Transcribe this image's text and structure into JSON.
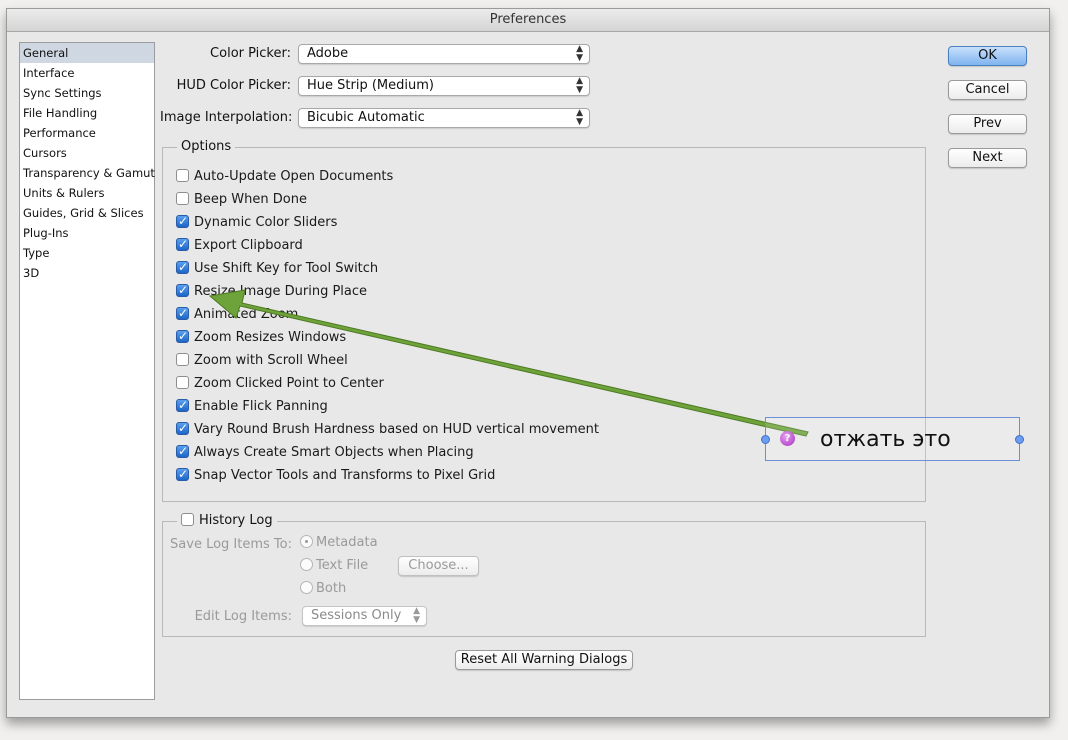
{
  "window": {
    "title": "Preferences"
  },
  "sidebar": {
    "items": [
      {
        "label": "General",
        "selected": true
      },
      {
        "label": "Interface"
      },
      {
        "label": "Sync Settings"
      },
      {
        "label": "File Handling"
      },
      {
        "label": "Performance"
      },
      {
        "label": "Cursors"
      },
      {
        "label": "Transparency & Gamut"
      },
      {
        "label": "Units & Rulers"
      },
      {
        "label": "Guides, Grid & Slices"
      },
      {
        "label": "Plug-Ins"
      },
      {
        "label": "Type"
      },
      {
        "label": "3D"
      }
    ]
  },
  "pickers": {
    "color_picker": {
      "label": "Color Picker:",
      "value": "Adobe"
    },
    "hud_color_picker": {
      "label": "HUD Color Picker:",
      "value": "Hue Strip (Medium)"
    },
    "image_interpolation": {
      "label": "Image Interpolation:",
      "value": "Bicubic Automatic"
    }
  },
  "options": {
    "legend": "Options",
    "checkboxes": [
      {
        "label": "Auto-Update Open Documents",
        "checked": false
      },
      {
        "label": "Beep When Done",
        "checked": false
      },
      {
        "label": "Dynamic Color Sliders",
        "checked": true
      },
      {
        "label": "Export Clipboard",
        "checked": true
      },
      {
        "label": "Use Shift Key for Tool Switch",
        "checked": true
      },
      {
        "label": "Resize Image During Place",
        "checked": true
      },
      {
        "label": "Animated Zoom",
        "checked": true
      },
      {
        "label": "Zoom Resizes Windows",
        "checked": true
      },
      {
        "label": "Zoom with Scroll Wheel",
        "checked": false
      },
      {
        "label": "Zoom Clicked Point to Center",
        "checked": false
      },
      {
        "label": "Enable Flick Panning",
        "checked": true
      },
      {
        "label": "Vary Round Brush Hardness based on HUD vertical movement",
        "checked": true
      },
      {
        "label": "Always Create Smart Objects when Placing",
        "checked": true
      },
      {
        "label": "Snap Vector Tools and Transforms to Pixel Grid",
        "checked": true
      }
    ]
  },
  "history": {
    "legend": "History Log",
    "checked": false,
    "save_label": "Save Log Items To:",
    "radios": [
      "Metadata",
      "Text File",
      "Both"
    ],
    "selected": "Metadata",
    "choose_button": "Choose...",
    "edit_label": "Edit Log Items:",
    "edit_value": "Sessions Only"
  },
  "buttons": {
    "ok": "OK",
    "cancel": "Cancel",
    "prev": "Prev",
    "next": "Next",
    "reset_warnings": "Reset All Warning Dialogs"
  },
  "annotation": {
    "text": "отжать это",
    "arrow_color": "#6ea23a",
    "badge": "?"
  }
}
